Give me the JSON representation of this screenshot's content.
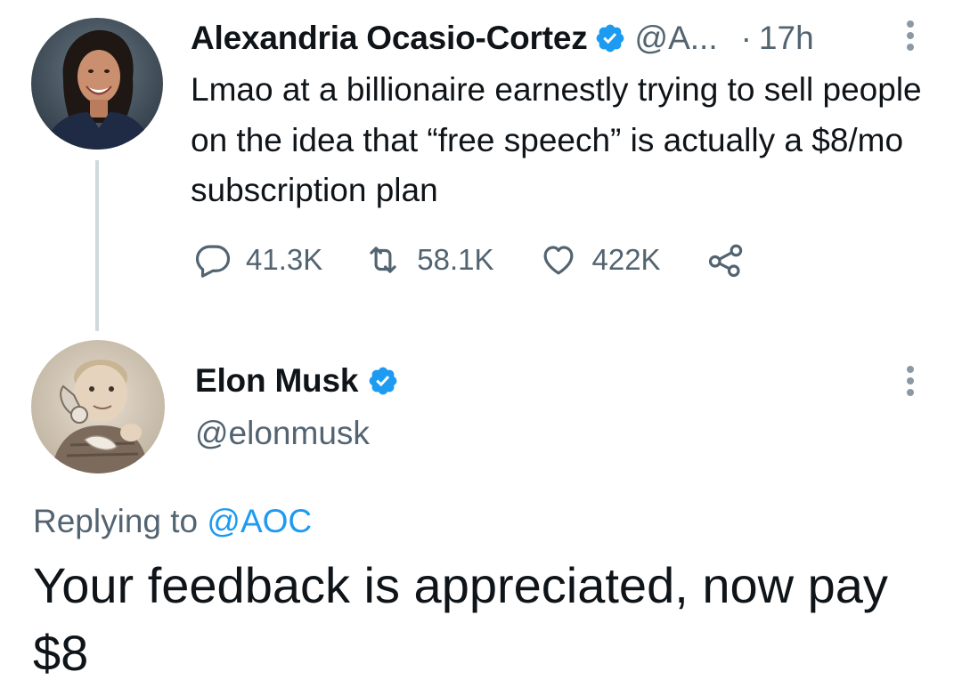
{
  "parent_tweet": {
    "author_name": "Alexandria Ocasio-Cortez",
    "author_handle": "@A...",
    "verified": true,
    "separator": "·",
    "time": "17h",
    "text": "Lmao at a billionaire earnestly trying to sell people on the idea that “free speech” is actually a $8/mo subscription plan",
    "stats": {
      "replies": "41.3K",
      "retweets": "58.1K",
      "likes": "422K"
    },
    "icons": [
      "reply-icon",
      "retweet-icon",
      "like-icon",
      "share-icon",
      "more-icon"
    ]
  },
  "reply_tweet": {
    "author_name": "Elon Musk",
    "author_handle": "@elonmusk",
    "verified": true,
    "replying_prefix": "Replying to",
    "replying_to": "@AOC",
    "text": "Your feedback is appreciated, now pay $8"
  },
  "colors": {
    "text_primary": "#0f1419",
    "text_secondary": "#536471",
    "accent": "#1d9bf0",
    "thread_line": "#cfd9de"
  }
}
